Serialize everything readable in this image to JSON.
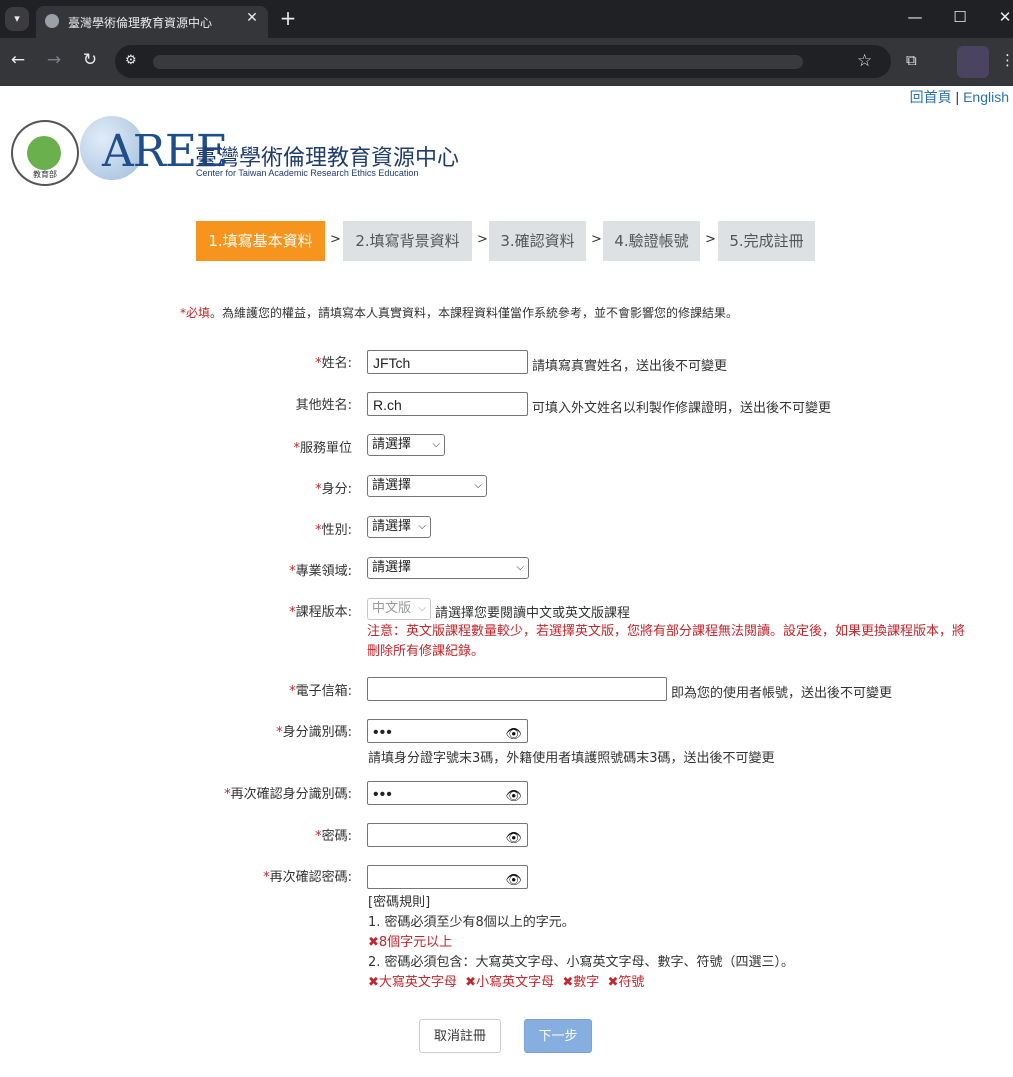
{
  "browser": {
    "tab_title": "臺灣學術倫理教育資源中心",
    "tab_close": "✕",
    "new_tab": "+",
    "window_controls": [
      "—",
      "☐",
      "✕"
    ]
  },
  "header": {
    "home_link": "回首頁",
    "separator": "|",
    "english_link": "English",
    "site_title": "臺灣學術倫理教育資源中心",
    "site_subtitle": "Center for Taiwan Academic Research Ethics Education",
    "moe_logo_text": "教育部",
    "aree_logo_text": "AREE"
  },
  "steps": [
    {
      "label": "1.填寫基本資料",
      "active": true
    },
    {
      "label": "2.填寫背景資料",
      "active": false
    },
    {
      "label": "3.確認資料",
      "active": false
    },
    {
      "label": "4.驗證帳號",
      "active": false
    },
    {
      "label": "5.完成註冊",
      "active": false
    }
  ],
  "step_separator": ">",
  "notice": {
    "required": "*必填",
    "text": "。為維護您的權益，請填寫本人真實資料，本課程資料僅當作系統參考，並不會影響您的修課結果。"
  },
  "form": {
    "name": {
      "label": "姓名:",
      "value": "JFTch",
      "hint": "請填寫真實姓名，送出後不可變更"
    },
    "other_name": {
      "label": "其他姓名:",
      "value": "R.ch",
      "hint": "可填入外文姓名以利製作修課證明，送出後不可變更"
    },
    "unit": {
      "label": "服務單位",
      "selected": "請選擇"
    },
    "identity": {
      "label": "身分:",
      "selected": "請選擇"
    },
    "gender": {
      "label": "性別:",
      "selected": "請選擇"
    },
    "field": {
      "label": "專業領域:",
      "selected": "請選擇"
    },
    "course_version": {
      "label": "課程版本:",
      "selected": "中文版",
      "hint": "請選擇您要閱讀中文或英文版課程",
      "warning": "注意：英文版課程數量較少，若選擇英文版，您將有部分課程無法閱讀。設定後，如果更換課程版本，將刪除所有修課紀錄。"
    },
    "email": {
      "label": "電子信箱:",
      "value": "",
      "hint": "即為您的使用者帳號，送出後不可變更"
    },
    "id_code": {
      "label": "身分識別碼:",
      "masked": "•••",
      "hint": "請填身分證字號末3碼，外籍使用者填護照號碼末3碼，送出後不可變更"
    },
    "id_code_confirm": {
      "label": "再次確認身分識別碼:",
      "masked": "•••"
    },
    "password": {
      "label": "密碼:",
      "masked": ""
    },
    "password_confirm": {
      "label": "再次確認密碼:",
      "masked": ""
    },
    "required_mark": "*",
    "eye_icon": "👁"
  },
  "password_rules": {
    "title": "[密碼規則]",
    "rule1": "1. 密碼必須至少有8個以上的字元。",
    "rule1_status": "✖8個字元以上",
    "rule2": "2. 密碼必須包含：大寫英文字母、小寫英文字母、數字、符號（四選三）。",
    "rule2_status": [
      "✖大寫英文字母",
      "✖小寫英文字母",
      "✖數字",
      "✖符號"
    ]
  },
  "buttons": {
    "cancel": "取消註冊",
    "next": "下一步"
  },
  "colors": {
    "active_step": "#f7941d",
    "inactive_step": "#dee1e4",
    "required_red": "#c1272d",
    "next_button": "#86aee0",
    "link_blue": "#2a6fb0"
  }
}
